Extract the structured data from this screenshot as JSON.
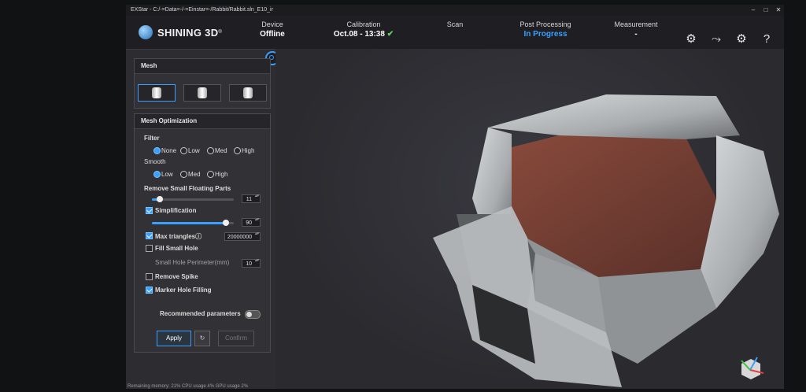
{
  "titlebar": {
    "title": "EXStar  -  C:/-=Data=-/-=Einstar=-/Rabbit/Rabbit.sln_E10_ir",
    "min": "–",
    "max": "□",
    "close": "✕"
  },
  "brand": {
    "name": "SHINING 3D",
    "trademark": "®"
  },
  "steps": [
    {
      "label": "Device",
      "value": "Offline",
      "active": false
    },
    {
      "label": "Calibration",
      "value": "Oct.08 - 13:38",
      "check": "✔"
    },
    {
      "label": "Scan",
      "value": ""
    },
    {
      "label": "Post Processing",
      "value": "In Progress",
      "active": true
    },
    {
      "label": "Measurement",
      "value": "-"
    }
  ],
  "mesh_panel": {
    "title": "Mesh"
  },
  "optimization": {
    "title": "Mesh Optimization",
    "filter": {
      "label": "Filter",
      "options": [
        "None",
        "Low",
        "Med",
        "High"
      ],
      "selected": "None"
    },
    "smooth": {
      "label": "Smooth",
      "options": [
        "Low",
        "Med",
        "High"
      ],
      "selected": "Low"
    },
    "floating": {
      "label": "Remove Small Floating Parts",
      "value": "11",
      "level": 0.1
    },
    "simplification": {
      "label": "Simplification",
      "checked": true,
      "value": "90",
      "level": 0.9
    },
    "max_triangles": {
      "label": "Max triangles",
      "info": "ⓘ",
      "checked": true,
      "value": "20000000"
    },
    "fill_small_hole": {
      "label": "Fill Small Hole",
      "checked": false
    },
    "hole_perimeter": {
      "label": "Small Hole Perimeter(mm)",
      "value": "10"
    },
    "remove_spike": {
      "label": "Remove Spike",
      "checked": false
    },
    "marker_hole": {
      "label": "Marker Hole Filling",
      "checked": true
    },
    "recommended": {
      "label": "Recommended parameters",
      "on": false
    },
    "buttons": {
      "apply": "Apply",
      "reset": "↻",
      "confirm": "Confirm"
    }
  },
  "status": {
    "text": "Remaining memory: 21% CPU usage 4% GPU usage 2%"
  },
  "colors": {
    "accent": "#3aa0ff",
    "check": "#5fd35f",
    "bg": "#2d2c31"
  },
  "icons": [
    "settings-gear-icon",
    "share-icon",
    "gear-icon",
    "help-icon"
  ]
}
